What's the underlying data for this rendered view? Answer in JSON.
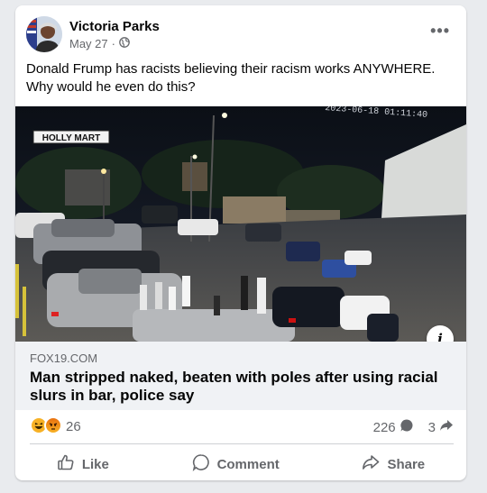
{
  "post": {
    "author": "Victoria Parks",
    "date": "May 27",
    "separator": "·",
    "text": "Donald Frump has racists believing their racism works ANYWHERE. Why would he even do this?"
  },
  "media": {
    "sign_text": "HOLLY MART",
    "timestamp": "2023-06-18 01:11:40"
  },
  "link": {
    "domain": "FOX19.COM",
    "title": "Man stripped naked, beaten with poles after using racial slurs in bar, police say"
  },
  "stats": {
    "reactions_count": "26",
    "comments_count": "226",
    "shares_count": "3"
  },
  "actions": {
    "like_label": "Like",
    "comment_label": "Comment",
    "share_label": "Share"
  },
  "icons": {
    "reaction_1": "haha-reaction-icon",
    "reaction_2": "angry-reaction-icon",
    "privacy": "globe-icon",
    "more": "more-options-icon",
    "info": "info-icon"
  },
  "colors": {
    "link_preview_bg": "#f0f2f5",
    "secondary_text": "#65676b",
    "reaction_yellow": "#f7b125",
    "reaction_angry": "#e9710f"
  }
}
